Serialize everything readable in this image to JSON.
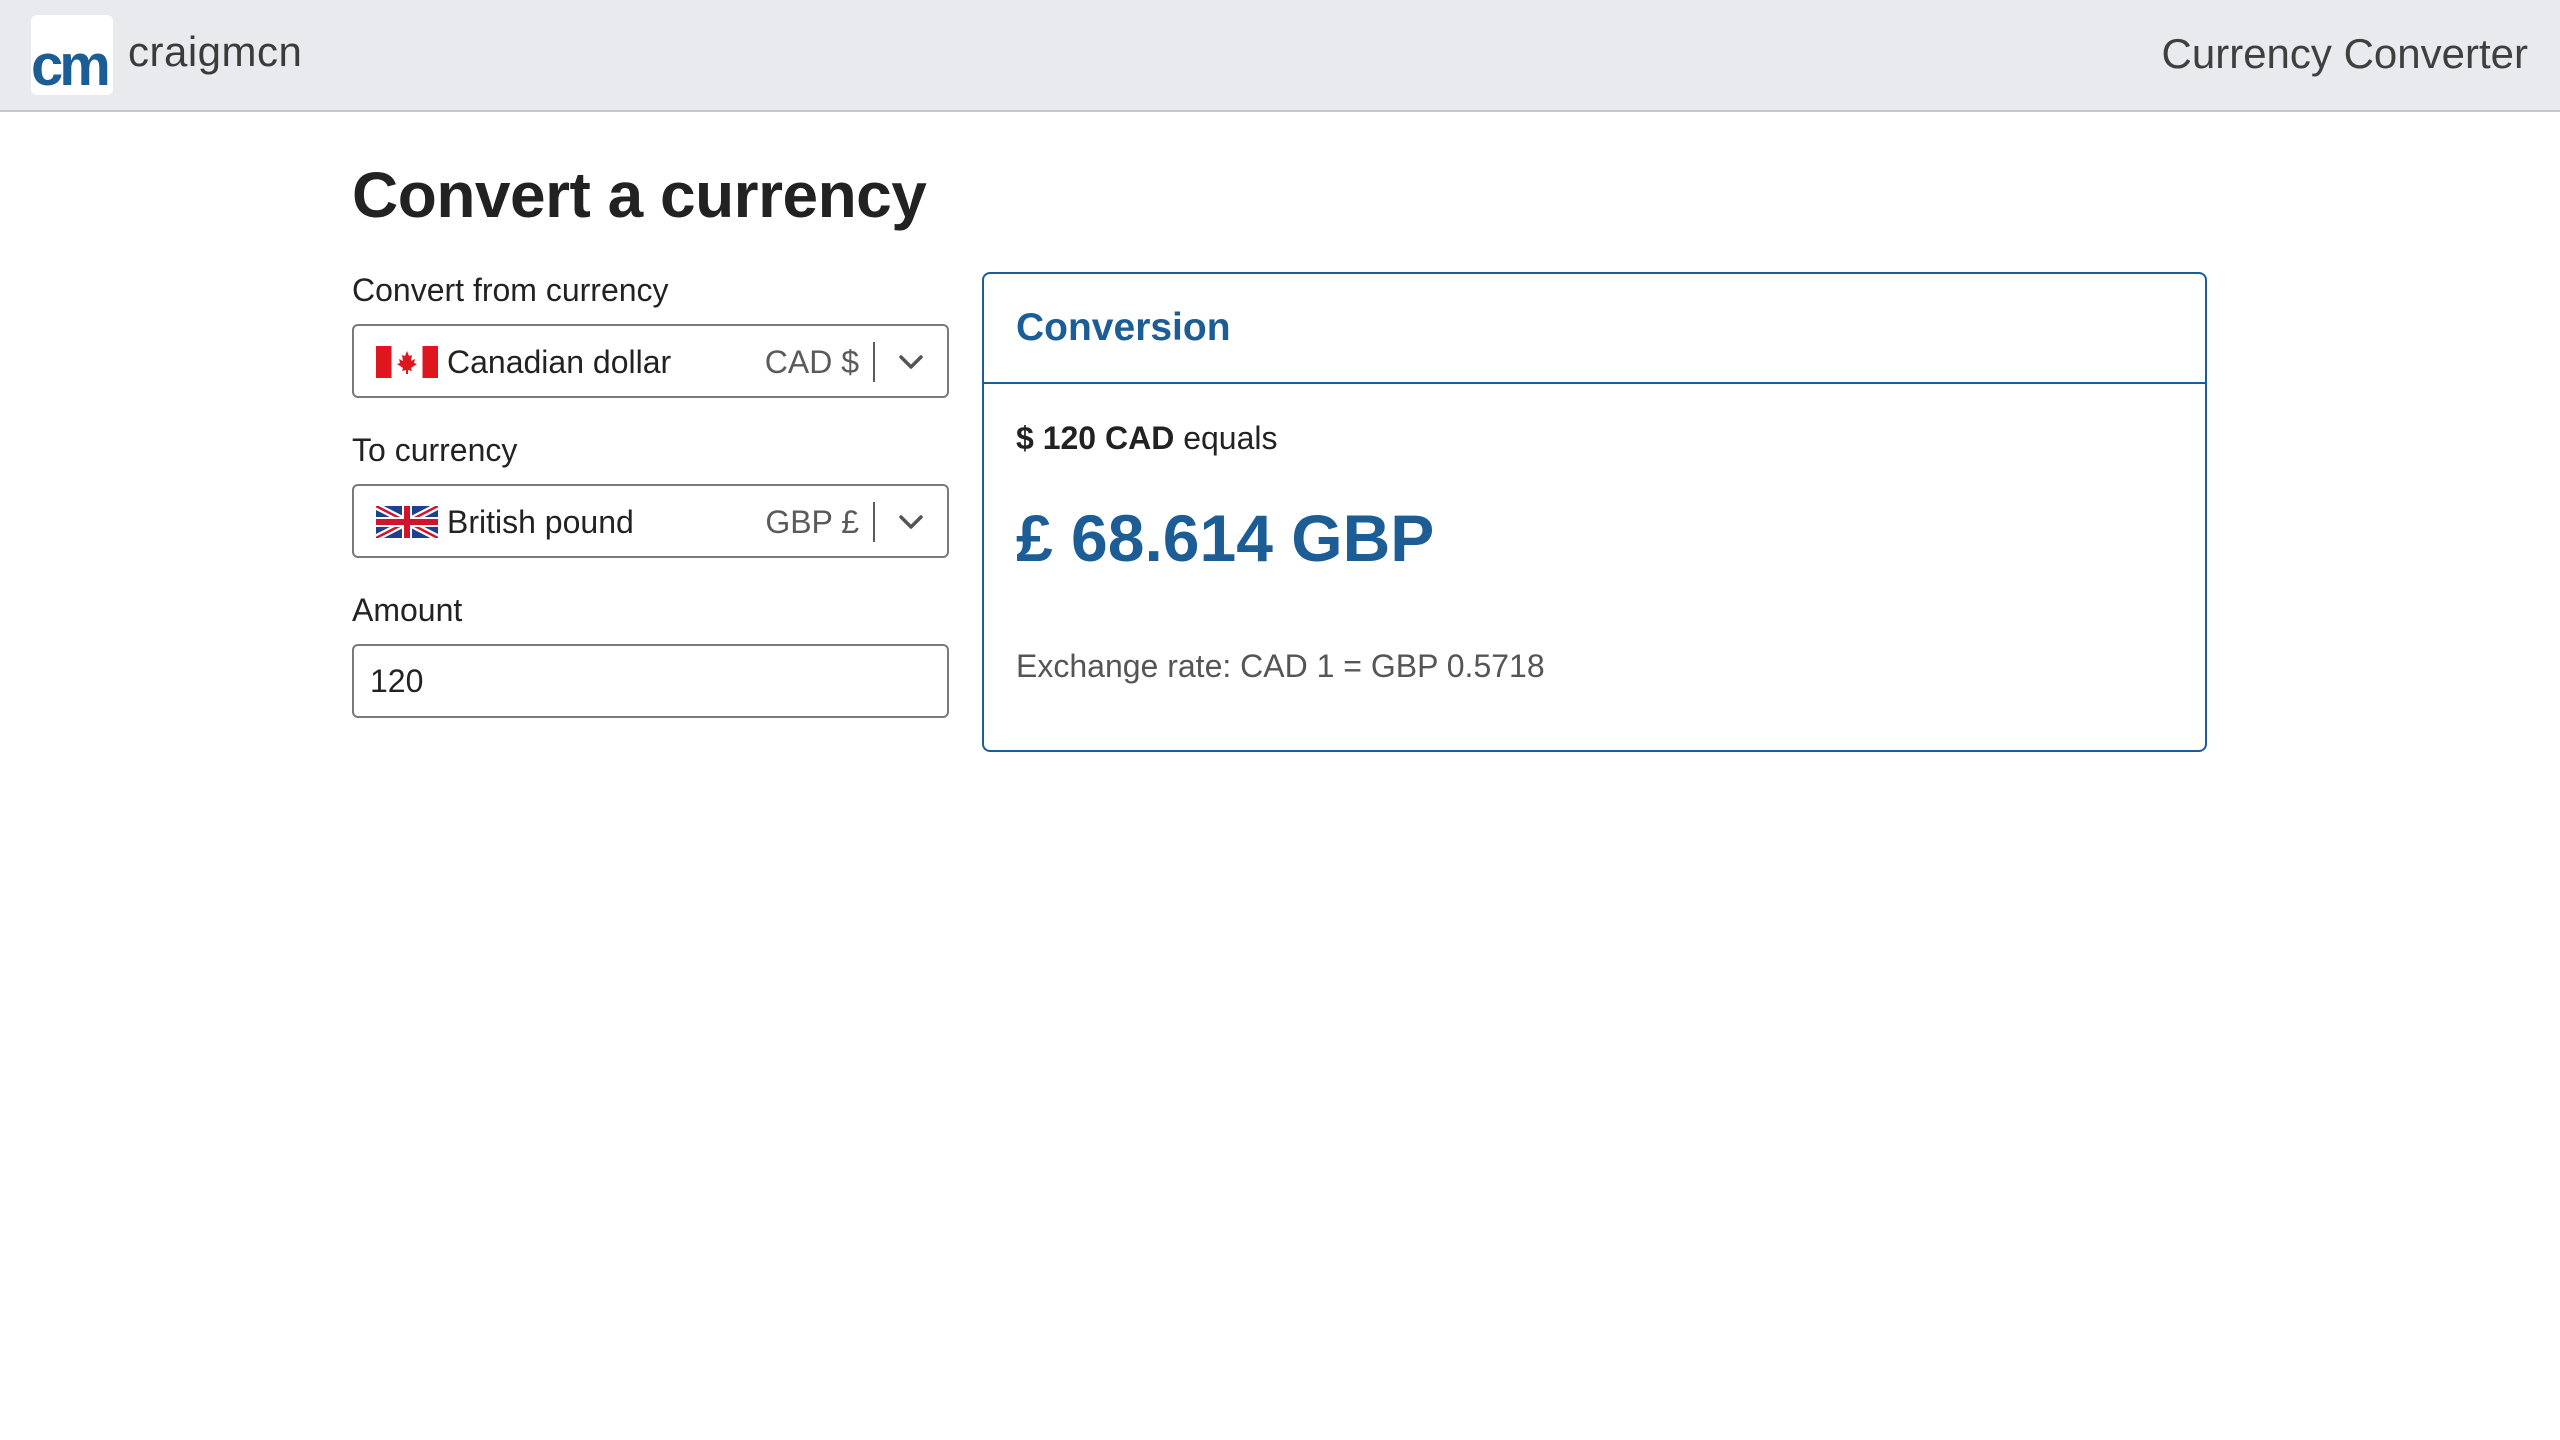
{
  "header": {
    "logo_text": "cm",
    "brand": "craigmcn",
    "app_title": "Currency Converter"
  },
  "page": {
    "title": "Convert a currency"
  },
  "form": {
    "from_label": "Convert from currency",
    "from": {
      "flag": "canada-flag",
      "name": "Canadian dollar",
      "code": "CAD $"
    },
    "to_label": "To currency",
    "to": {
      "flag": "uk-flag",
      "name": "British pound",
      "code": "GBP £"
    },
    "amount_label": "Amount",
    "amount_value": "120"
  },
  "conversion": {
    "title": "Conversion",
    "source_amount": "$ 120 CAD",
    "equals_word": "equals",
    "result": "£ 68.614 GBP",
    "rate": "Exchange rate: CAD 1 = GBP 0.5718"
  },
  "colors": {
    "accent": "#1c5d96",
    "topbar_bg": "#e9eaee",
    "border": "#7a7a7a"
  }
}
